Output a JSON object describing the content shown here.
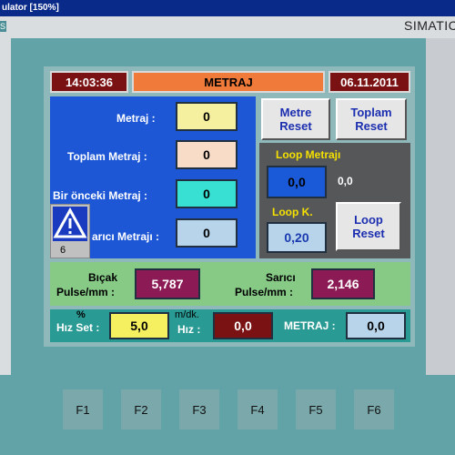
{
  "window": {
    "title": "ulator [150%]"
  },
  "panel": {
    "brand": "S",
    "model": "SIMATIC"
  },
  "header": {
    "time": "14:03:36",
    "title": "METRAJ",
    "date": "06.11.2011"
  },
  "left_panel": {
    "metraj_label": "Metraj :",
    "metraj_value": "0",
    "toplam_label": "Toplam Metraj :",
    "toplam_value": "0",
    "onceki_label": "Bir önceki Metraj :",
    "onceki_value": "0",
    "sarici_label": "arıcı Metrajı :",
    "sarici_value": "0",
    "alarm_count": "6"
  },
  "buttons": {
    "metre_reset": "Metre Reset",
    "toplam_reset": "Toplam Reset",
    "loop_reset": "Loop Reset"
  },
  "loop": {
    "metraj_label": "Loop Metrajı",
    "metraj_value": "0,0",
    "metraj_side": "0,0",
    "k_label": "Loop K.",
    "k_value": "0,20"
  },
  "pulse": {
    "bicak_label_1": "Bıçak",
    "bicak_label_2": "Pulse/mm :",
    "bicak_value": "5,787",
    "sarici_label_1": "Sarıcı",
    "sarici_label_2": "Pulse/mm :",
    "sarici_value": "2,146"
  },
  "speed": {
    "percent_label": "%",
    "hiz_set_label": "Hız Set :",
    "hiz_set_value": "5,0",
    "unit_label": "m/dk.",
    "hiz_label": "Hız :",
    "hiz_value": "0,0",
    "metraj_label": "METRAJ :",
    "metraj_value": "0,0"
  },
  "function_keys": [
    "F1",
    "F2",
    "F3",
    "F4",
    "F5",
    "F6"
  ],
  "colors": {
    "accent_orange": "#f07a3a",
    "dark_red": "#7a1214",
    "blue_panel": "#1d57d6",
    "purple_value": "#8b1a55"
  }
}
